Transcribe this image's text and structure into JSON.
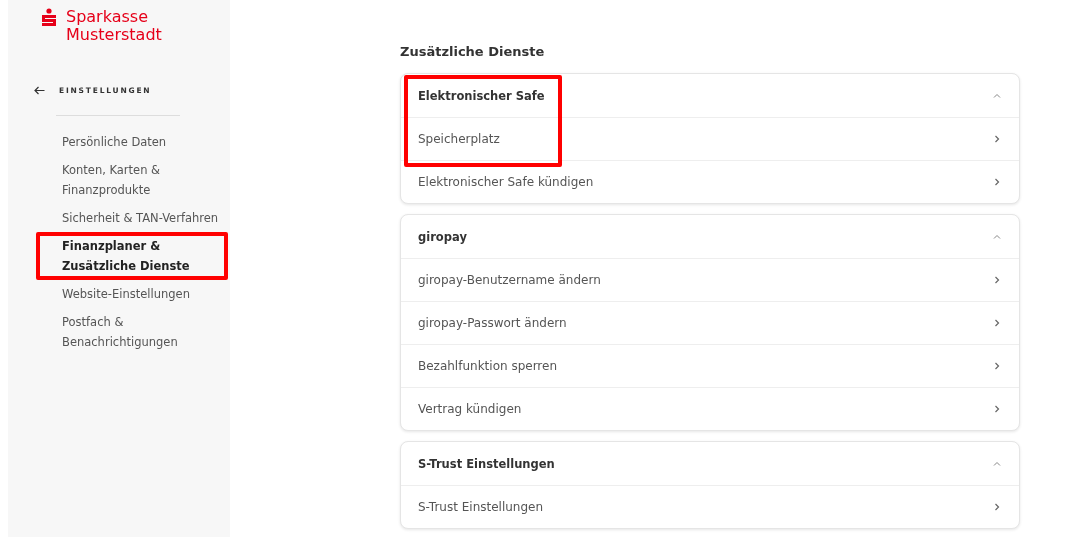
{
  "brand": {
    "line_1": "Sparkasse",
    "line_2": "Musterstadt"
  },
  "sidebar": {
    "back_label": "EINSTELLUNGEN",
    "items": [
      {
        "label": "Persönliche Daten",
        "selected": false,
        "highlighted": false
      },
      {
        "label": "Konten, Karten & Finanzprodukte",
        "selected": false,
        "highlighted": false
      },
      {
        "label": "Sicherheit & TAN-Verfahren",
        "selected": false,
        "highlighted": false
      },
      {
        "label": "Finanzplaner & Zusätzliche Dienste",
        "selected": true,
        "highlighted": true
      },
      {
        "label": "Website-Einstellungen",
        "selected": false,
        "highlighted": false
      },
      {
        "label": "Postfach & Benachrichtigungen",
        "selected": false,
        "highlighted": false
      }
    ]
  },
  "page_title": "Zusätzliche Dienste",
  "sections": [
    {
      "title": "Elektronischer Safe",
      "expanded": true,
      "highlighted": true,
      "items": [
        {
          "label": "Speicherplatz",
          "highlighted": true
        },
        {
          "label": "Elektronischer Safe kündigen",
          "highlighted": false
        }
      ]
    },
    {
      "title": "giropay",
      "expanded": true,
      "highlighted": false,
      "items": [
        {
          "label": "giropay-Benutzername ändern",
          "highlighted": false
        },
        {
          "label": "giropay-Passwort ändern",
          "highlighted": false
        },
        {
          "label": "Bezahlfunktion sperren",
          "highlighted": false
        },
        {
          "label": "Vertrag kündigen",
          "highlighted": false
        }
      ]
    },
    {
      "title": "S-Trust Einstellungen",
      "expanded": true,
      "highlighted": false,
      "items": [
        {
          "label": "S-Trust Einstellungen",
          "highlighted": false
        }
      ]
    }
  ]
}
